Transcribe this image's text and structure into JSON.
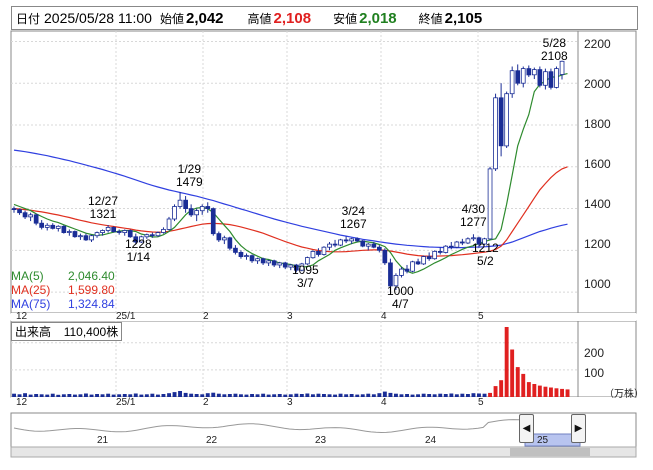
{
  "header": {
    "date_label": "日付",
    "datetime": "2025/05/28 11:00",
    "open_label": "始値",
    "open_value": "2,042",
    "high_label": "高値",
    "high_value": "2,108",
    "low_label": "安値",
    "low_value": "2,018",
    "close_label": "終値",
    "close_value": "2,105"
  },
  "colors": {
    "up": "#ffffff",
    "down": "#1a2d96",
    "ma5": "#2e8b2e",
    "ma25": "#e03020",
    "ma75": "#3040e0",
    "volume": "#1a2d96",
    "volume_spike": "#e02020",
    "high_text": "#e02020",
    "low_text": "#208020"
  },
  "legend": [
    {
      "label": "MA(5)",
      "value": "2,046.40",
      "color": "#2e8b2e"
    },
    {
      "label": "MA(25)",
      "value": "1,599.80",
      "color": "#e03020"
    },
    {
      "label": "MA(75)",
      "value": "1,324.84",
      "color": "#3040e0"
    }
  ],
  "volume_panel": {
    "title": "出来高",
    "value": "110,400株",
    "unit": "（万株）",
    "ticks": [
      "200",
      "100"
    ]
  },
  "price_axis_ticks": [
    "2200",
    "2000",
    "1800",
    "1600",
    "1400",
    "1200",
    "1000"
  ],
  "x_labels": [
    "12",
    "25/1",
    "2",
    "3",
    "4",
    "5"
  ],
  "nav_labels": [
    "21",
    "22",
    "23",
    "24",
    "25"
  ],
  "annotations": [
    {
      "line1": "5/28",
      "line2": "2108"
    },
    {
      "line1": "1/29",
      "line2": "1479"
    },
    {
      "line1": "12/27",
      "line2": "1321"
    },
    {
      "line1": "3/24",
      "line2": "1267"
    },
    {
      "line1": "4/30",
      "line2": "1277"
    },
    {
      "line1": "1228",
      "line2": "1/14"
    },
    {
      "line1": "1095",
      "line2": "3/7"
    },
    {
      "line1": "1000",
      "line2": "4/7"
    },
    {
      "line1": "1212",
      "line2": "5/2"
    }
  ],
  "chart_data": {
    "type": "candlestick",
    "ylim": [
      900,
      2250
    ],
    "volume_ylim": [
      0,
      280
    ],
    "candles": [
      {
        "o": 1400,
        "h": 1410,
        "l": 1380,
        "c": 1395
      },
      {
        "o": 1395,
        "h": 1400,
        "l": 1370,
        "c": 1380
      },
      {
        "o": 1380,
        "h": 1390,
        "l": 1350,
        "c": 1360
      },
      {
        "o": 1360,
        "h": 1380,
        "l": 1340,
        "c": 1370
      },
      {
        "o": 1370,
        "h": 1375,
        "l": 1320,
        "c": 1330
      },
      {
        "o": 1330,
        "h": 1345,
        "l": 1300,
        "c": 1310
      },
      {
        "o": 1310,
        "h": 1330,
        "l": 1295,
        "c": 1320
      },
      {
        "o": 1320,
        "h": 1330,
        "l": 1300,
        "c": 1305
      },
      {
        "o": 1305,
        "h": 1320,
        "l": 1290,
        "c": 1315
      },
      {
        "o": 1315,
        "h": 1320,
        "l": 1280,
        "c": 1285
      },
      {
        "o": 1285,
        "h": 1300,
        "l": 1270,
        "c": 1290
      },
      {
        "o": 1290,
        "h": 1295,
        "l": 1260,
        "c": 1265
      },
      {
        "o": 1265,
        "h": 1280,
        "l": 1250,
        "c": 1270
      },
      {
        "o": 1270,
        "h": 1280,
        "l": 1245,
        "c": 1250
      },
      {
        "o": 1250,
        "h": 1275,
        "l": 1240,
        "c": 1270
      },
      {
        "o": 1270,
        "h": 1290,
        "l": 1260,
        "c": 1285
      },
      {
        "o": 1285,
        "h": 1300,
        "l": 1270,
        "c": 1295
      },
      {
        "o": 1295,
        "h": 1321,
        "l": 1285,
        "c": 1310
      },
      {
        "o": 1310,
        "h": 1315,
        "l": 1285,
        "c": 1290
      },
      {
        "o": 1290,
        "h": 1300,
        "l": 1275,
        "c": 1285
      },
      {
        "o": 1285,
        "h": 1300,
        "l": 1270,
        "c": 1295
      },
      {
        "o": 1295,
        "h": 1300,
        "l": 1260,
        "c": 1265
      },
      {
        "o": 1265,
        "h": 1280,
        "l": 1228,
        "c": 1240
      },
      {
        "o": 1240,
        "h": 1270,
        "l": 1235,
        "c": 1265
      },
      {
        "o": 1265,
        "h": 1280,
        "l": 1255,
        "c": 1275
      },
      {
        "o": 1275,
        "h": 1285,
        "l": 1260,
        "c": 1270
      },
      {
        "o": 1270,
        "h": 1290,
        "l": 1265,
        "c": 1285
      },
      {
        "o": 1285,
        "h": 1310,
        "l": 1280,
        "c": 1300
      },
      {
        "o": 1300,
        "h": 1360,
        "l": 1295,
        "c": 1350
      },
      {
        "o": 1350,
        "h": 1420,
        "l": 1340,
        "c": 1410
      },
      {
        "o": 1410,
        "h": 1479,
        "l": 1400,
        "c": 1440
      },
      {
        "o": 1440,
        "h": 1460,
        "l": 1380,
        "c": 1400
      },
      {
        "o": 1400,
        "h": 1420,
        "l": 1360,
        "c": 1370
      },
      {
        "o": 1370,
        "h": 1400,
        "l": 1340,
        "c": 1390
      },
      {
        "o": 1390,
        "h": 1420,
        "l": 1370,
        "c": 1410
      },
      {
        "o": 1410,
        "h": 1430,
        "l": 1380,
        "c": 1400
      },
      {
        "o": 1400,
        "h": 1405,
        "l": 1270,
        "c": 1280
      },
      {
        "o": 1280,
        "h": 1290,
        "l": 1240,
        "c": 1250
      },
      {
        "o": 1250,
        "h": 1270,
        "l": 1230,
        "c": 1260
      },
      {
        "o": 1260,
        "h": 1265,
        "l": 1200,
        "c": 1210
      },
      {
        "o": 1210,
        "h": 1225,
        "l": 1180,
        "c": 1190
      },
      {
        "o": 1190,
        "h": 1200,
        "l": 1160,
        "c": 1170
      },
      {
        "o": 1170,
        "h": 1185,
        "l": 1155,
        "c": 1175
      },
      {
        "o": 1175,
        "h": 1180,
        "l": 1140,
        "c": 1150
      },
      {
        "o": 1150,
        "h": 1165,
        "l": 1135,
        "c": 1160
      },
      {
        "o": 1160,
        "h": 1165,
        "l": 1130,
        "c": 1140
      },
      {
        "o": 1140,
        "h": 1155,
        "l": 1125,
        "c": 1150
      },
      {
        "o": 1150,
        "h": 1155,
        "l": 1120,
        "c": 1130
      },
      {
        "o": 1130,
        "h": 1145,
        "l": 1115,
        "c": 1140
      },
      {
        "o": 1140,
        "h": 1145,
        "l": 1110,
        "c": 1120
      },
      {
        "o": 1120,
        "h": 1135,
        "l": 1105,
        "c": 1130
      },
      {
        "o": 1130,
        "h": 1135,
        "l": 1095,
        "c": 1105
      },
      {
        "o": 1105,
        "h": 1140,
        "l": 1100,
        "c": 1135
      },
      {
        "o": 1135,
        "h": 1170,
        "l": 1130,
        "c": 1165
      },
      {
        "o": 1165,
        "h": 1200,
        "l": 1160,
        "c": 1195
      },
      {
        "o": 1195,
        "h": 1210,
        "l": 1170,
        "c": 1180
      },
      {
        "o": 1180,
        "h": 1220,
        "l": 1175,
        "c": 1215
      },
      {
        "o": 1215,
        "h": 1240,
        "l": 1200,
        "c": 1230
      },
      {
        "o": 1230,
        "h": 1250,
        "l": 1215,
        "c": 1225
      },
      {
        "o": 1225,
        "h": 1255,
        "l": 1220,
        "c": 1250
      },
      {
        "o": 1250,
        "h": 1267,
        "l": 1235,
        "c": 1245
      },
      {
        "o": 1245,
        "h": 1260,
        "l": 1230,
        "c": 1255
      },
      {
        "o": 1255,
        "h": 1262,
        "l": 1240,
        "c": 1245
      },
      {
        "o": 1245,
        "h": 1250,
        "l": 1215,
        "c": 1220
      },
      {
        "o": 1220,
        "h": 1235,
        "l": 1200,
        "c": 1230
      },
      {
        "o": 1230,
        "h": 1240,
        "l": 1210,
        "c": 1215
      },
      {
        "o": 1215,
        "h": 1225,
        "l": 1190,
        "c": 1200
      },
      {
        "o": 1200,
        "h": 1210,
        "l": 1130,
        "c": 1140
      },
      {
        "o": 1140,
        "h": 1160,
        "l": 1000,
        "c": 1030
      },
      {
        "o": 1030,
        "h": 1090,
        "l": 1010,
        "c": 1080
      },
      {
        "o": 1080,
        "h": 1120,
        "l": 1070,
        "c": 1110
      },
      {
        "o": 1110,
        "h": 1130,
        "l": 1090,
        "c": 1100
      },
      {
        "o": 1100,
        "h": 1150,
        "l": 1095,
        "c": 1145
      },
      {
        "o": 1145,
        "h": 1160,
        "l": 1130,
        "c": 1135
      },
      {
        "o": 1135,
        "h": 1175,
        "l": 1130,
        "c": 1170
      },
      {
        "o": 1170,
        "h": 1190,
        "l": 1150,
        "c": 1160
      },
      {
        "o": 1160,
        "h": 1200,
        "l": 1155,
        "c": 1195
      },
      {
        "o": 1195,
        "h": 1215,
        "l": 1180,
        "c": 1190
      },
      {
        "o": 1190,
        "h": 1225,
        "l": 1185,
        "c": 1220
      },
      {
        "o": 1220,
        "h": 1240,
        "l": 1205,
        "c": 1215
      },
      {
        "o": 1215,
        "h": 1245,
        "l": 1210,
        "c": 1240
      },
      {
        "o": 1240,
        "h": 1255,
        "l": 1225,
        "c": 1235
      },
      {
        "o": 1235,
        "h": 1262,
        "l": 1230,
        "c": 1255
      },
      {
        "o": 1255,
        "h": 1277,
        "l": 1245,
        "c": 1260
      },
      {
        "o": 1260,
        "h": 1265,
        "l": 1212,
        "c": 1230
      },
      {
        "o": 1230,
        "h": 1260,
        "l": 1225,
        "c": 1255
      },
      {
        "o": 1255,
        "h": 1600,
        "l": 1250,
        "c": 1590
      },
      {
        "o": 1590,
        "h": 1950,
        "l": 1580,
        "c": 1930
      },
      {
        "o": 1930,
        "h": 2000,
        "l": 1650,
        "c": 1700
      },
      {
        "o": 1700,
        "h": 1960,
        "l": 1690,
        "c": 1950
      },
      {
        "o": 1950,
        "h": 2080,
        "l": 1930,
        "c": 2060
      },
      {
        "o": 2060,
        "h": 2090,
        "l": 1990,
        "c": 2000
      },
      {
        "o": 2000,
        "h": 2080,
        "l": 1980,
        "c": 2070
      },
      {
        "o": 2070,
        "h": 2085,
        "l": 2030,
        "c": 2040
      },
      {
        "o": 2040,
        "h": 2075,
        "l": 2020,
        "c": 2065
      },
      {
        "o": 2065,
        "h": 2080,
        "l": 1980,
        "c": 1990
      },
      {
        "o": 1990,
        "h": 2070,
        "l": 1970,
        "c": 2055
      },
      {
        "o": 2055,
        "h": 2070,
        "l": 1970,
        "c": 1980
      },
      {
        "o": 1980,
        "h": 2080,
        "l": 1975,
        "c": 2070
      },
      {
        "o": 2042,
        "h": 2108,
        "l": 2018,
        "c": 2105
      }
    ],
    "volume": [
      12,
      10,
      14,
      9,
      11,
      10,
      9,
      12,
      8,
      10,
      11,
      9,
      10,
      13,
      9,
      11,
      10,
      12,
      9,
      10,
      11,
      10,
      13,
      9,
      10,
      12,
      9,
      11,
      14,
      18,
      22,
      15,
      12,
      11,
      10,
      14,
      16,
      12,
      10,
      11,
      12,
      10,
      9,
      11,
      10,
      12,
      9,
      10,
      11,
      9,
      10,
      12,
      11,
      13,
      10,
      12,
      11,
      10,
      9,
      12,
      10,
      11,
      9,
      10,
      12,
      10,
      14,
      20,
      15,
      12,
      10,
      11,
      9,
      10,
      12,
      11,
      10,
      12,
      11,
      13,
      10,
      12,
      11,
      14,
      13,
      12,
      15,
      40,
      62,
      258,
      175,
      110,
      85,
      55,
      48,
      42,
      38,
      35,
      32,
      30,
      28
    ],
    "ma5": [
      1420,
      1410,
      1400,
      1390,
      1375,
      1362,
      1350,
      1340,
      1333,
      1322,
      1312,
      1302,
      1292,
      1282,
      1276,
      1272,
      1274,
      1280,
      1287,
      1292,
      1295,
      1294,
      1290,
      1278,
      1272,
      1264,
      1265,
      1275,
      1290,
      1310,
      1340,
      1370,
      1392,
      1402,
      1405,
      1400,
      1380,
      1350,
      1320,
      1290,
      1252,
      1222,
      1200,
      1185,
      1172,
      1160,
      1156,
      1148,
      1140,
      1136,
      1132,
      1126,
      1120,
      1122,
      1130,
      1150,
      1165,
      1180,
      1200,
      1212,
      1222,
      1232,
      1240,
      1244,
      1240,
      1236,
      1228,
      1218,
      1190,
      1150,
      1120,
      1100,
      1090,
      1098,
      1110,
      1125,
      1140,
      1152,
      1165,
      1180,
      1192,
      1205,
      1215,
      1222,
      1232,
      1242,
      1250,
      1255,
      1300,
      1420,
      1560,
      1700,
      1780,
      1850,
      1960,
      1995,
      2010,
      2030,
      2030,
      2040,
      2046
    ],
    "ma25": [
      1400,
      1398,
      1395,
      1392,
      1388,
      1384,
      1379,
      1374,
      1369,
      1363,
      1357,
      1350,
      1344,
      1338,
      1332,
      1327,
      1322,
      1318,
      1314,
      1310,
      1306,
      1302,
      1297,
      1293,
      1290,
      1288,
      1287,
      1288,
      1291,
      1296,
      1302,
      1308,
      1314,
      1320,
      1325,
      1328,
      1329,
      1328,
      1326,
      1323,
      1318,
      1312,
      1305,
      1298,
      1290,
      1282,
      1272,
      1262,
      1252,
      1242,
      1233,
      1224,
      1216,
      1210,
      1204,
      1199,
      1196,
      1194,
      1193,
      1193,
      1194,
      1196,
      1198,
      1200,
      1201,
      1202,
      1202,
      1200,
      1197,
      1192,
      1187,
      1182,
      1178,
      1175,
      1173,
      1172,
      1172,
      1173,
      1174,
      1175,
      1177,
      1179,
      1182,
      1185,
      1188,
      1191,
      1196,
      1204,
      1220,
      1250,
      1290,
      1330,
      1370,
      1410,
      1450,
      1490,
      1520,
      1548,
      1572,
      1590,
      1600
    ],
    "ma75": [
      1680,
      1676,
      1672,
      1668,
      1663,
      1658,
      1653,
      1647,
      1641,
      1635,
      1629,
      1622,
      1615,
      1608,
      1601,
      1594,
      1587,
      1579,
      1571,
      1563,
      1555,
      1546,
      1537,
      1528,
      1519,
      1511,
      1503,
      1496,
      1489,
      1483,
      1477,
      1471,
      1465,
      1459,
      1452,
      1445,
      1438,
      1430,
      1422,
      1414,
      1406,
      1398,
      1390,
      1382,
      1374,
      1366,
      1358,
      1350,
      1343,
      1336,
      1329,
      1322,
      1315,
      1309,
      1303,
      1297,
      1291,
      1285,
      1279,
      1273,
      1268,
      1263,
      1258,
      1253,
      1249,
      1245,
      1241,
      1237,
      1233,
      1230,
      1227,
      1224,
      1222,
      1220,
      1218,
      1216,
      1215,
      1214,
      1213,
      1213,
      1213,
      1213,
      1214,
      1215,
      1216,
      1217,
      1219,
      1221,
      1225,
      1232,
      1240,
      1250,
      1260,
      1270,
      1280,
      1290,
      1298,
      1306,
      1313,
      1320,
      1325
    ]
  }
}
